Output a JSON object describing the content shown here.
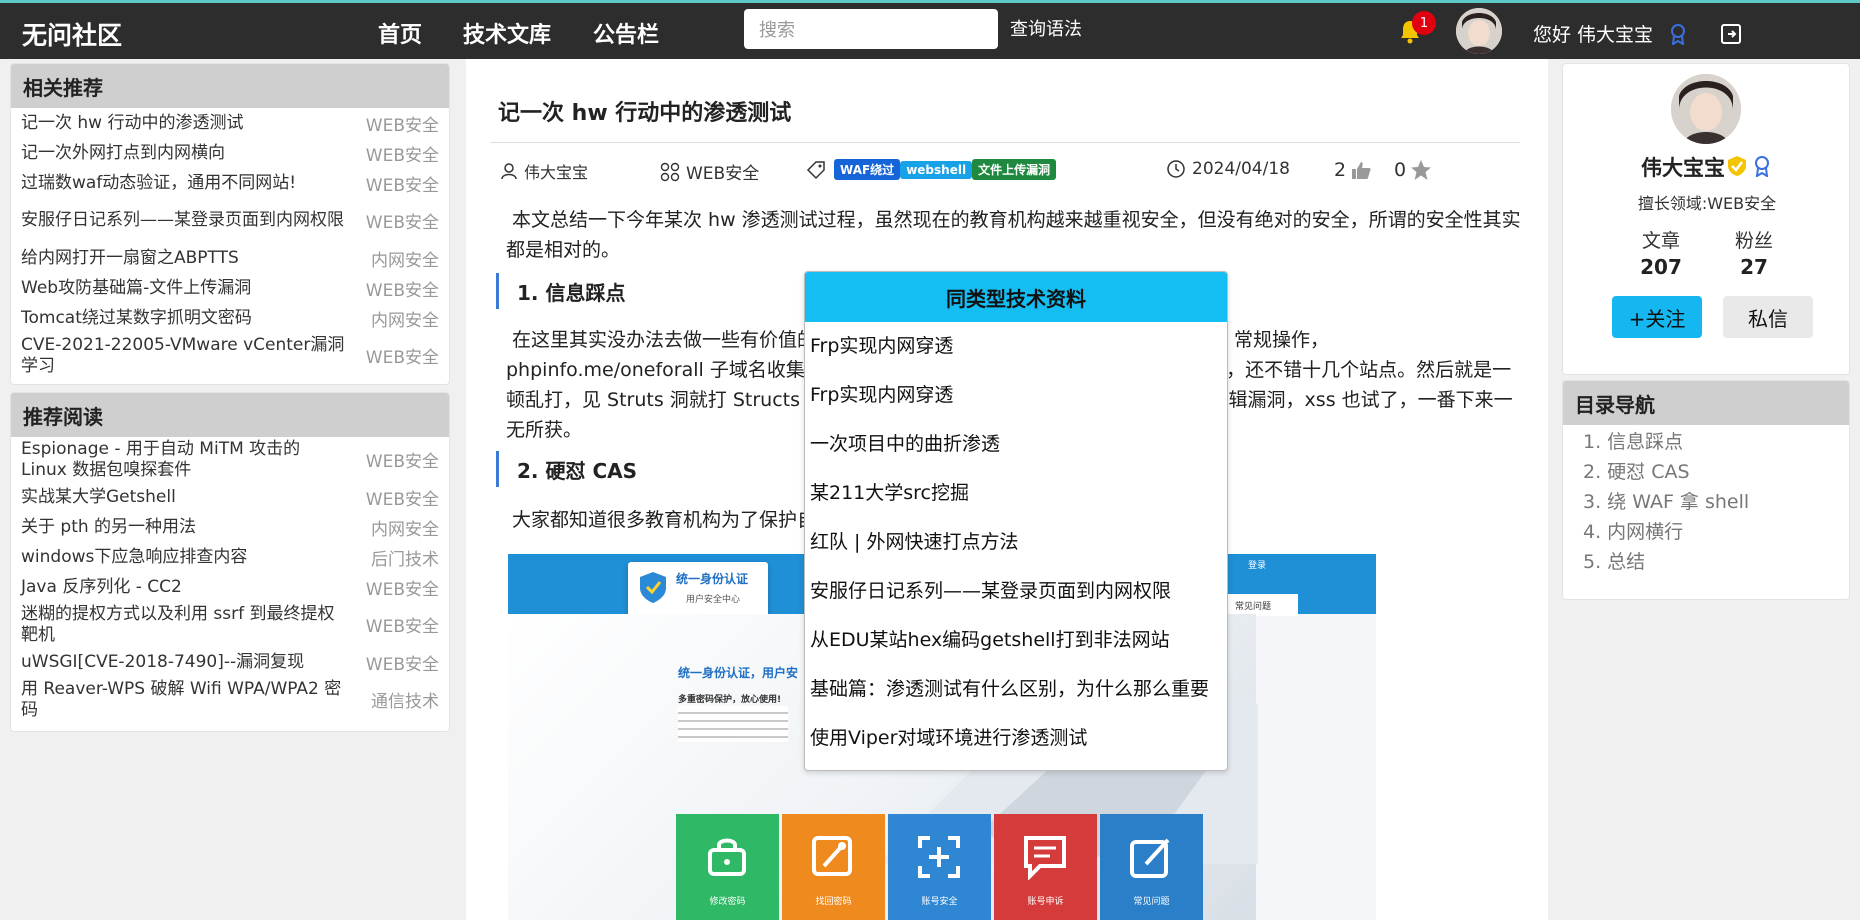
{
  "header": {
    "brand": "无问社区",
    "nav": [
      "首页",
      "技术文库",
      "公告栏"
    ],
    "search_placeholder": "搜索",
    "query_syntax": "查询语法",
    "notification_count": "1",
    "greeting": "您好 伟大宝宝"
  },
  "recommended": {
    "title": "相关推荐",
    "items": [
      {
        "title": "记一次 hw 行动中的渗透测试",
        "category": "WEB安全"
      },
      {
        "title": "记一次外网打点到内网横向",
        "category": "WEB安全"
      },
      {
        "title": "过瑞数waf动态验证，通用不同网站!",
        "category": "WEB安全"
      },
      {
        "title": "安服仔日记系列——某登录页面到内网权限",
        "category": "WEB安全"
      },
      {
        "title": "给内网打开一扇窗之ABPTTS",
        "category": "内网安全"
      },
      {
        "title": "Web攻防基础篇-文件上传漏洞",
        "category": "WEB安全"
      },
      {
        "title": "Tomcat绕过某数字抓明文密码",
        "category": "内网安全"
      },
      {
        "title": "CVE-2021-22005-VMware vCenter漏洞学习",
        "category": "WEB安全"
      }
    ]
  },
  "reading": {
    "title": "推荐阅读",
    "items": [
      {
        "title": "Espionage - 用于自动 MiTM 攻击的 Linux 数据包嗅探套件",
        "category": "WEB安全"
      },
      {
        "title": "实战某大学Getshell",
        "category": "WEB安全"
      },
      {
        "title": "关于 pth 的另一种用法",
        "category": "内网安全"
      },
      {
        "title": "windows下应急响应排查内容",
        "category": "后门技术"
      },
      {
        "title": "Java 反序列化 - CC2",
        "category": "WEB安全"
      },
      {
        "title": "迷糊的提权方式以及利用 ssrf 到最终提权靶机",
        "category": "WEB安全"
      },
      {
        "title": "uWSGI[CVE-2018-7490]--漏洞复现",
        "category": "WEB安全"
      },
      {
        "title": "用 Reaver-WPS 破解 Wifi WPA/WPA2 密码",
        "category": "通信技术"
      }
    ]
  },
  "article": {
    "title": "记一次 hw 行动中的渗透测试",
    "author": "伟大宝宝",
    "category": "WEB安全",
    "tags": [
      {
        "label": "WAF绕过",
        "color": "#1565d8"
      },
      {
        "label": "webshell",
        "color": "#17a2e8"
      },
      {
        "label": "文件上传漏洞",
        "color": "#1f8a3f"
      }
    ],
    "date": "2024/04/18",
    "likes": "2",
    "stars": "0",
    "intro": "本文总结一下今年某次 hw 渗透测试过程，虽然现在的教育机构越来越重视安全，但没有绝对的安全，所谓的安全性其实都是相对的。",
    "section1": "1. 信息踩点",
    "section1_text": "在这里其实没办法去做一些有价值的信息收集，一是时间紧，二话不说信息收集一波，常规操作，phpinfo.me/oneforall 子域名收集，找到一些敏感泄露信息，nmap 端口开扫，等等，还不错十几个站点。然后就是一顿乱打，见 Struts 洞就打 Structs 洞，见 tomcat 就后台弱口令，各种 sql 注入，逻辑漏洞，xss 也试了，一番下来一无所获。",
    "section2": "2. 硬怼 CAS",
    "section2_text": "大家都知道很多教育机构为了保护自己的系统，纷纷对接了统一验证平台",
    "image": {
      "banner_title": "统一身份认证",
      "banner_sub": "用户安全中心",
      "right_link": "常见问题",
      "login_link": "登录",
      "body_title": "统一身份认证，用户安",
      "body_sub": "多重密码保护，放心使用!",
      "tiles": [
        {
          "label": "修改密码",
          "color": "#2fb865"
        },
        {
          "label": "找回密码",
          "color": "#ef8a1f"
        },
        {
          "label": "账号安全",
          "color": "#2f87d4"
        },
        {
          "label": "账号申诉",
          "color": "#d63b3b"
        },
        {
          "label": "常见问题",
          "color": "#2a7fc8"
        }
      ]
    }
  },
  "profile": {
    "name": "伟大宝宝",
    "domain": "擅长领域:WEB安全",
    "articles_label": "文章",
    "articles": "207",
    "fans_label": "粉丝",
    "fans": "27",
    "follow": "+关注",
    "message": "私信"
  },
  "toc": {
    "title": "目录导航",
    "items": [
      "1. 信息踩点",
      "2. 硬怼 CAS",
      "3. 绕 WAF 拿 shell",
      "4. 内网横行",
      "5. 总结"
    ]
  },
  "popup": {
    "title": "同类型技术资料",
    "items": [
      "Frp实现内网穿透",
      "Frp实现内网穿透",
      "一次项目中的曲折渗透",
      "某211大学src挖掘",
      "红队 | 外网快速打点方法",
      "安服仔日记系列——某登录页面到内网权限",
      "从EDU某站hex编码getshell打到非法网站",
      "基础篇：渗透测试有什么区别，为什么那么重要",
      "使用Viper对域环境进行渗透测试"
    ]
  }
}
